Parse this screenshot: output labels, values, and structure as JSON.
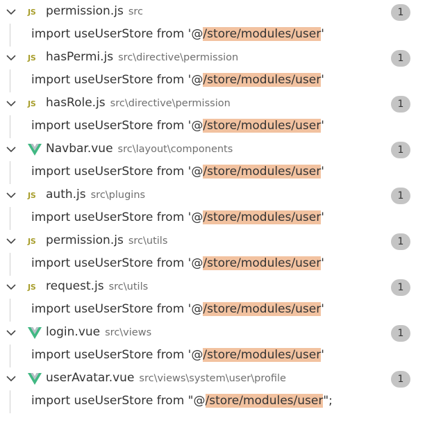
{
  "match": {
    "prefix": "import useUserStore from '@",
    "prefix_dq": "import useUserStore from \"@",
    "highlight": "/store/modules/user",
    "suffix": "'",
    "suffix_dq": "\";"
  },
  "files": [
    {
      "icon": "js-file-icon",
      "icon_label": "JS",
      "name": "permission.js",
      "path": "src",
      "count": "1",
      "quote": "single"
    },
    {
      "icon": "js-file-icon",
      "icon_label": "JS",
      "name": "hasPermi.js",
      "path": "src\\directive\\permission",
      "count": "1",
      "quote": "single"
    },
    {
      "icon": "js-file-icon",
      "icon_label": "JS",
      "name": "hasRole.js",
      "path": "src\\directive\\permission",
      "count": "1",
      "quote": "single"
    },
    {
      "icon": "vue-file-icon",
      "icon_label": "",
      "name": "Navbar.vue",
      "path": "src\\layout\\components",
      "count": "1",
      "quote": "single"
    },
    {
      "icon": "js-file-icon",
      "icon_label": "JS",
      "name": "auth.js",
      "path": "src\\plugins",
      "count": "1",
      "quote": "single"
    },
    {
      "icon": "js-file-icon",
      "icon_label": "JS",
      "name": "permission.js",
      "path": "src\\utils",
      "count": "1",
      "quote": "single"
    },
    {
      "icon": "js-file-icon",
      "icon_label": "JS",
      "name": "request.js",
      "path": "src\\utils",
      "count": "1",
      "quote": "single"
    },
    {
      "icon": "vue-file-icon",
      "icon_label": "",
      "name": "login.vue",
      "path": "src\\views",
      "count": "1",
      "quote": "single"
    },
    {
      "icon": "vue-file-icon",
      "icon_label": "",
      "name": "userAvatar.vue",
      "path": "src\\views\\system\\user\\profile",
      "count": "1",
      "quote": "double"
    }
  ],
  "colors": {
    "highlight": "#f2c2a0",
    "js_icon": "#a89e2c",
    "vue_icon": "#41b883",
    "badge": "#c4c4c4"
  }
}
